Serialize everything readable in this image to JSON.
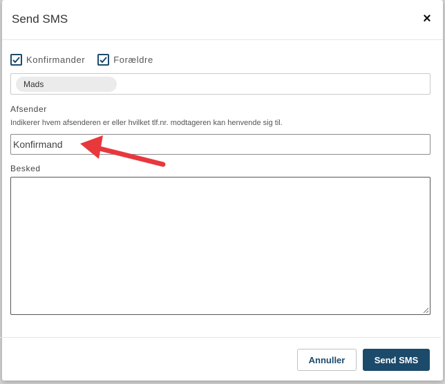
{
  "dialog": {
    "title": "Send SMS",
    "close_symbol": "×"
  },
  "recipients": {
    "options": [
      {
        "label": "Konfirmander",
        "checked": true
      },
      {
        "label": "Forældre",
        "checked": true
      }
    ],
    "chips": [
      "Mads"
    ]
  },
  "sender": {
    "label": "Afsender",
    "hint": "Indikerer hvem afsenderen er eller hvilket tlf.nr. modtageren kan henvende sig til.",
    "value": "Konfirmand"
  },
  "message": {
    "label": "Besked",
    "value": ""
  },
  "footer": {
    "cancel_label": "Annuller",
    "send_label": "Send SMS"
  },
  "colors": {
    "primary": "#1b4a6b",
    "annotation_arrow": "#e8383d"
  },
  "icons": {
    "close": "close-icon",
    "checkbox": "checkmark-icon",
    "annotation": "red-arrow-annotation"
  }
}
